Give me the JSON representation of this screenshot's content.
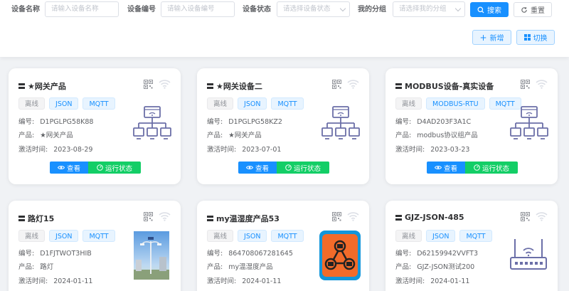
{
  "filters": {
    "name_label": "设备名称",
    "name_placeholder": "请输入设备名称",
    "serial_label": "设备编号",
    "serial_placeholder": "请输入设备编号",
    "status_label": "设备状态",
    "status_placeholder": "请选择设备状态",
    "group_label": "我的分组",
    "group_placeholder": "请选择我的分组",
    "search_label": "搜索",
    "reset_label": "重置"
  },
  "toolbar": {
    "add_label": "新增",
    "switch_label": "切换"
  },
  "labels": {
    "serial": "编号:",
    "product": "产品:",
    "activated": "激活时间:",
    "view": "查看",
    "run_status": "运行状态"
  },
  "cards": [
    {
      "title": "★网关产品",
      "status": "离线",
      "tags": [
        "JSON",
        "MQTT"
      ],
      "serial": "D1PGLPG58K88",
      "product": "★网关产品",
      "activated": "2023-08-29",
      "icon": "gateway-icon"
    },
    {
      "title": "★网关设备二",
      "status": "离线",
      "tags": [
        "JSON",
        "MQTT"
      ],
      "serial": "D1PGLPG58KZ2",
      "product": "★网关产品",
      "activated": "2023-07-01",
      "icon": "gateway-icon"
    },
    {
      "title": "MODBUS设备-真实设备",
      "status": "离线",
      "tags": [
        "MODBUS-RTU",
        "MQTT"
      ],
      "serial": "D4AD203F3A1C",
      "product": "modbus协议组产品",
      "activated": "2023-03-23",
      "icon": "gateway-icon"
    },
    {
      "title": "路灯15",
      "status": "离线",
      "tags": [
        "JSON",
        "MQTT"
      ],
      "serial": "D1FJTWOT3HIB",
      "product": "路灯",
      "activated": "2024-01-11",
      "icon": "street-lamp-image"
    },
    {
      "title": "my温湿度产品53",
      "status": "离线",
      "tags": [
        "JSON",
        "MQTT"
      ],
      "serial": "864708067281645",
      "product": "my温湿度产品",
      "activated": "2024-01-11",
      "icon": "network-app-icon"
    },
    {
      "title": "GJZ-JSON-485",
      "status": "离线",
      "tags": [
        "JSON",
        "MQTT"
      ],
      "serial": "D62159942VVFT3",
      "product": "GJZ-JSON测试200",
      "activated": "2024-01-11",
      "icon": "router-icon"
    }
  ],
  "colors": {
    "primary": "#1890ff",
    "success": "#13ce66",
    "device_icon": "#6b6fa8"
  }
}
